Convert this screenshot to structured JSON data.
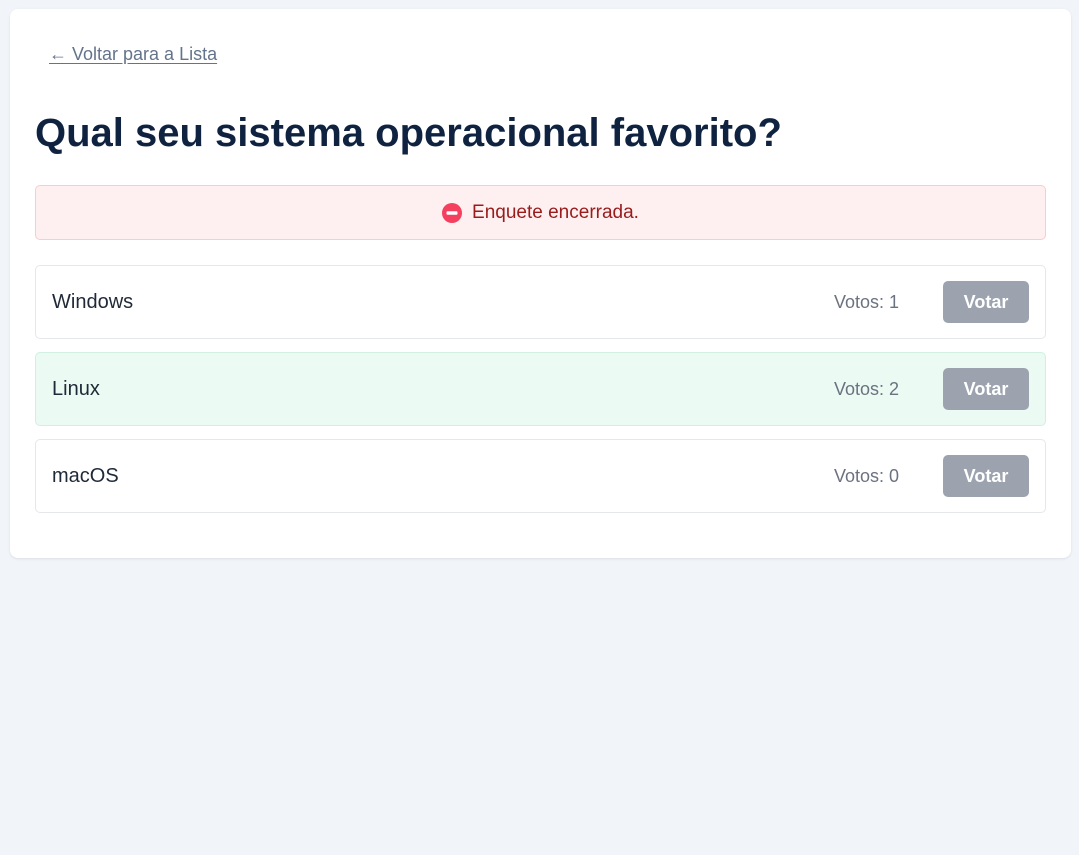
{
  "back_link": "← Voltar para a Lista",
  "poll": {
    "title": "Qual seu sistema operacional favorito?",
    "status": {
      "message": "Enquete encerrada.",
      "icon": "no-entry-icon",
      "color": "#f43f5e"
    },
    "options": [
      {
        "name": "Windows",
        "votes_label": "Votos: 1",
        "votes": 1,
        "button_label": "Votar",
        "leading": false
      },
      {
        "name": "Linux",
        "votes_label": "Votos: 2",
        "votes": 2,
        "button_label": "Votar",
        "leading": true
      },
      {
        "name": "macOS",
        "votes_label": "Votos: 0",
        "votes": 0,
        "button_label": "Votar",
        "leading": false
      }
    ]
  },
  "colors": {
    "background": "#f1f5f9",
    "card": "#ffffff",
    "title": "#0f2341",
    "alert_bg": "#fef0f0",
    "alert_text": "#991b1b",
    "leading_bg": "#ebfaf3",
    "button_disabled": "#9ca3af"
  }
}
